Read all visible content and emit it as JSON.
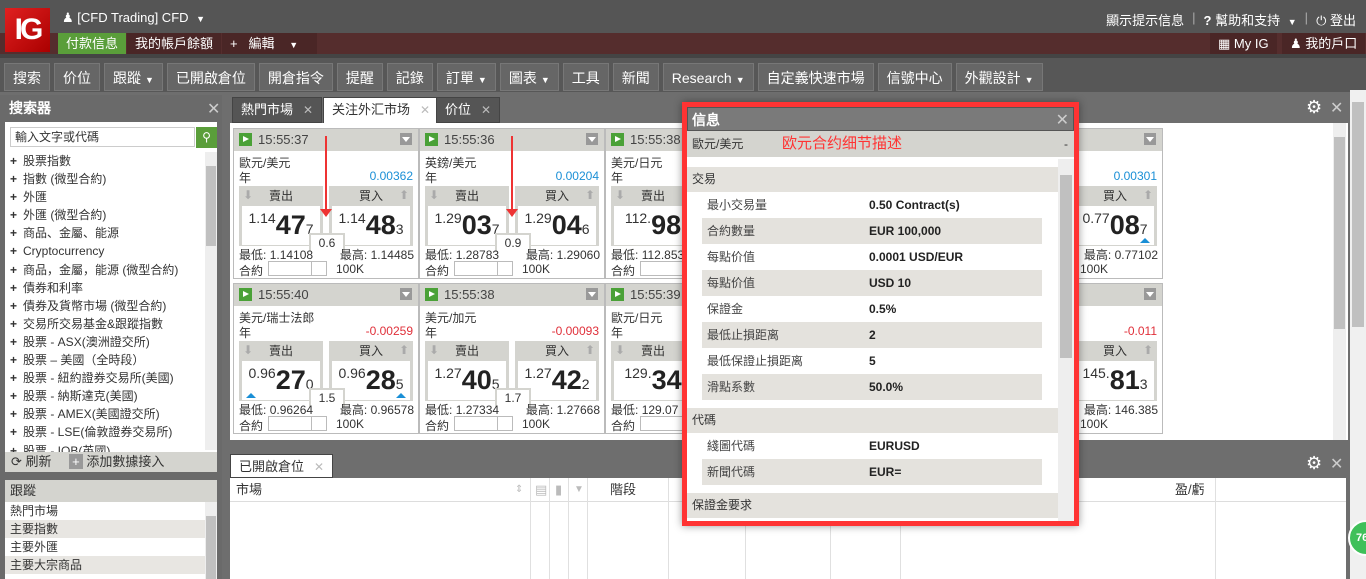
{
  "header": {
    "logo": "IG",
    "account": "[CFD Trading] CFD",
    "links": [
      "顯示提示信息",
      "幫助和支持",
      "登出"
    ],
    "row2_left": [
      "付款信息",
      "我的帳戶餘額",
      "編輯"
    ],
    "row2_right": [
      "My IG",
      "我的戶口"
    ]
  },
  "nav": [
    {
      "label": "搜索"
    },
    {
      "label": "价位"
    },
    {
      "label": "跟蹤",
      "dropdown": true
    },
    {
      "label": "已開啟倉位"
    },
    {
      "label": "開倉指令"
    },
    {
      "label": "提醒"
    },
    {
      "label": "記錄"
    },
    {
      "label": "訂單",
      "dropdown": true
    },
    {
      "label": "圖表",
      "dropdown": true
    },
    {
      "label": "工具"
    },
    {
      "label": "新聞"
    },
    {
      "label": "Research",
      "dropdown": true
    },
    {
      "label": "自定義快速市場"
    },
    {
      "label": "信號中心"
    },
    {
      "label": "外觀設計",
      "dropdown": true
    }
  ],
  "search_panel": {
    "title": "搜索器",
    "placeholder": "輸入文字或代碼",
    "items": [
      "股票指數",
      "指數 (微型合約)",
      "外匯",
      "外匯 (微型合約)",
      "商品、金屬、能源",
      "Cryptocurrency",
      "商品，金屬，能源 (微型合約)",
      "債券和利率",
      "債券及貨幣市場 (微型合約)",
      "交易所交易基金&跟蹤指數",
      "股票 - ASX(澳洲證交所)",
      "股票 – 美國（全時段）",
      "股票 - 紐約證券交易所(美國)",
      "股票 - 納斯達克(美國)",
      "股票 - AMEX(美國證交所)",
      "股票 - LSE(倫敦證券交易所)",
      "股票 - IOB(英國)"
    ],
    "refresh": "刷新",
    "add_feed": "添加數據接入"
  },
  "tracking": {
    "title": "跟蹤",
    "items": [
      "熱門市場",
      "主要指數",
      "主要外匯",
      "主要大宗商品"
    ]
  },
  "main_tabs": [
    "熱門市場",
    "关注外汇市场",
    "价位"
  ],
  "card_labels": {
    "sell": "賣出",
    "buy": "買入",
    "year": "年",
    "low": "最低:",
    "high": "最高:",
    "qty": "合約"
  },
  "cards": [
    {
      "time": "15:55:37",
      "name": "歐元/美元",
      "change": "0.00362",
      "dir": "up",
      "sell": [
        "1.14",
        "47",
        "7"
      ],
      "buy": [
        "1.14",
        "48",
        "3"
      ],
      "spread": "0.6",
      "low": "1.14108",
      "high": "1.14485",
      "size": "100K"
    },
    {
      "time": "15:55:36",
      "name": "英鎊/美元",
      "change": "0.00204",
      "dir": "up",
      "sell": [
        "1.29",
        "03",
        "7"
      ],
      "buy": [
        "1.29",
        "04",
        "6"
      ],
      "spread": "0.9",
      "low": "1.28783",
      "high": "1.29060",
      "size": "100K"
    },
    {
      "time": "15:55:38",
      "name": "美元/日元",
      "sell": [
        "112.",
        "98",
        ""
      ],
      "low": "112.853"
    },
    {},
    {
      "change": "0.00301",
      "dir": "up",
      "buy": [
        "0.77",
        "08",
        "7"
      ],
      "buy_tick": true,
      "high": "0.77102",
      "size": "100K"
    },
    {
      "time": "15:55:40",
      "name": "美元/瑞士法郎",
      "change": "-0.00259",
      "dir": "down",
      "sell": [
        "0.96",
        "27",
        "0"
      ],
      "buy": [
        "0.96",
        "28",
        "5"
      ],
      "sell_tick": true,
      "buy_tick": true,
      "spread": "1.5",
      "low": "0.96264",
      "high": "0.96578",
      "size": "100K"
    },
    {
      "time": "15:55:38",
      "name": "美元/加元",
      "change": "-0.00093",
      "dir": "down",
      "sell": [
        "1.27",
        "40",
        "5"
      ],
      "buy": [
        "1.27",
        "42",
        "2"
      ],
      "spread": "1.7",
      "low": "1.27334",
      "high": "1.27668",
      "size": "100K"
    },
    {
      "time": "15:55:39",
      "name": "歐元/日元",
      "sell": [
        "129.",
        "34",
        ""
      ],
      "low": "129.07"
    },
    {},
    {
      "change": "-0.011",
      "dir": "down",
      "buy": [
        "145.",
        "81",
        "3"
      ],
      "high": "146.385",
      "size": "100K"
    }
  ],
  "colors": {
    "up": "#1a8fd6",
    "down": "#e0303a",
    "annotation": "#ff3333",
    "green": "#4aa137"
  },
  "positions": {
    "tab": "已開啟倉位",
    "columns": {
      "market": "市場",
      "stage": "階段",
      "pnl": "盈/虧"
    }
  },
  "modal": {
    "title": "信息",
    "market": "歐元/美元",
    "annotation": "欧元合约细节描述",
    "collapse": "-",
    "sections": [
      {
        "title": "交易",
        "rows": [
          [
            "最小交易量",
            "0.50 Contract(s)"
          ],
          [
            "合約數量",
            "EUR 100,000"
          ],
          [
            "每點价值",
            "0.0001 USD/EUR"
          ],
          [
            "每點价值",
            "USD 10"
          ],
          [
            "保證金",
            "0.5%"
          ],
          [
            "最低止損距离",
            "2"
          ],
          [
            "最低保證止損距离",
            "5"
          ],
          [
            "滑點系數",
            "50.0%"
          ]
        ]
      },
      {
        "title": "代碼",
        "rows": [
          [
            "綫圖代碼",
            "EURUSD"
          ],
          [
            "新聞代碼",
            "EUR="
          ]
        ]
      },
      {
        "title": "保證金要求",
        "rows": []
      }
    ]
  },
  "badge": "76"
}
